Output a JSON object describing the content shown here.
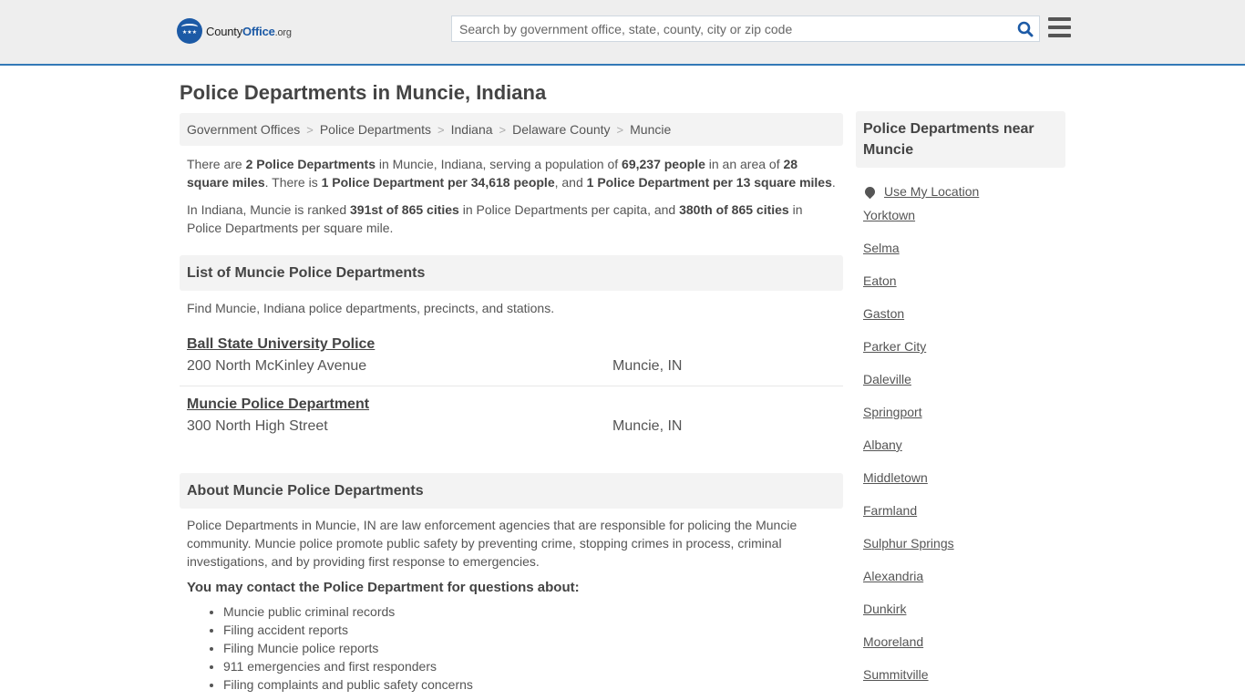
{
  "header": {
    "logo": {
      "county": "County",
      "office": "Office",
      "org": ".org",
      "stars": "★★★"
    },
    "search_placeholder": "Search by government office, state, county, city or zip code",
    "search_icon": "search-icon",
    "menu_icon": "hamburger-menu-icon",
    "accent_color": "#3379b7"
  },
  "page_title": "Police Departments in Muncie, Indiana",
  "breadcrumb": [
    "Government Offices",
    "Police Departments",
    "Indiana",
    "Delaware County",
    "Muncie"
  ],
  "breadcrumb_separator": ">",
  "summary": {
    "p1": {
      "t1": "There are ",
      "b1": "2 Police Departments",
      "t2": " in Muncie, Indiana, serving a population of ",
      "b2": "69,237 people",
      "t3": " in an area of ",
      "b3": "28 square miles",
      "t4": ". There is ",
      "b4": "1 Police Department per 34,618 people",
      "t5": ", and ",
      "b5": "1 Police Department per 13 square miles",
      "t6": "."
    },
    "p2": {
      "t1": "In Indiana, Muncie is ranked ",
      "b1": "391st of 865 cities",
      "t2": " in Police Departments per capita, and ",
      "b2": "380th of 865 cities",
      "t3": " in Police Departments per square mile."
    }
  },
  "list_section": {
    "title": "List of Muncie Police Departments",
    "intro": "Find Muncie, Indiana police departments, precincts, and stations.",
    "items": [
      {
        "name": "Ball State University Police",
        "address": "200 North McKinley Avenue",
        "city": "Muncie, IN"
      },
      {
        "name": "Muncie Police Department",
        "address": "300 North High Street",
        "city": "Muncie, IN"
      }
    ]
  },
  "about_section": {
    "title": "About Muncie Police Departments",
    "body": "Police Departments in Muncie, IN are law enforcement agencies that are responsible for policing the Muncie community. Muncie police promote public safety by preventing crime, stopping crimes in process, criminal investigations, and by providing first response to emergencies.",
    "subhead": "You may contact the Police Department for questions about:",
    "topics": [
      "Muncie public criminal records",
      "Filing accident reports",
      "Filing Muncie police reports",
      "911 emergencies and first responders",
      "Filing complaints and public safety concerns"
    ]
  },
  "sidebar": {
    "title": "Police Departments near Muncie",
    "use_location": "Use My Location",
    "nearby": [
      "Yorktown",
      "Selma",
      "Eaton",
      "Gaston",
      "Parker City",
      "Daleville",
      "Springport",
      "Albany",
      "Middletown",
      "Farmland",
      "Sulphur Springs",
      "Alexandria",
      "Dunkirk",
      "Mooreland",
      "Summitville"
    ]
  }
}
